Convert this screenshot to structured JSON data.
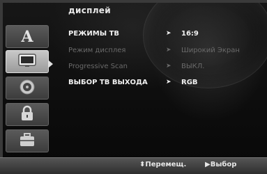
{
  "header": {
    "title": "дисплей"
  },
  "sidebar": {
    "tabs": [
      {
        "icon": "letter-a-icon",
        "glyph": "A"
      },
      {
        "icon": "tv-screen-icon",
        "glyph": ""
      },
      {
        "icon": "speaker-icon",
        "glyph": ""
      },
      {
        "icon": "padlock-icon",
        "glyph": ""
      },
      {
        "icon": "toolbox-icon",
        "glyph": ""
      }
    ],
    "active_index": 1
  },
  "menu": {
    "items": [
      {
        "label": "РЕЖИМЫ ТВ",
        "value": "16:9",
        "enabled": true
      },
      {
        "label": "Режим дисплея",
        "value": "Широкий Экран",
        "enabled": false
      },
      {
        "label": "Progressive Scan",
        "value": "ВЫКЛ.",
        "enabled": false
      },
      {
        "label": "ВЫБОР ТВ ВЫХОДА",
        "value": "RGB",
        "enabled": true
      }
    ],
    "arrow": "➤"
  },
  "footer": {
    "move_label": "⬍Перемещ.",
    "select_label": "▶Выбор"
  },
  "colors": {
    "enabled_text": "#f0f0f0",
    "disabled_text": "#6a6a6a",
    "footer_bg": "#3e3e3e"
  }
}
